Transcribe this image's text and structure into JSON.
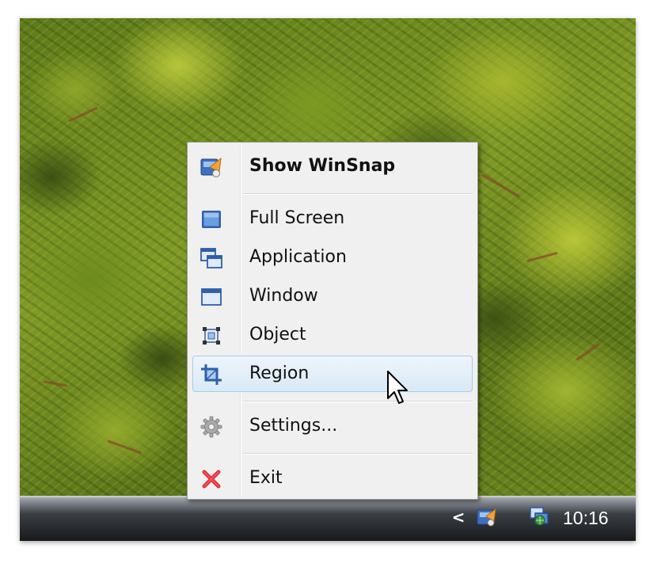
{
  "menu": {
    "items": [
      {
        "label": "Show WinSnap",
        "icon": "winsnap-app-icon",
        "bold": true
      },
      {
        "label": "Full Screen",
        "icon": "full-screen-icon"
      },
      {
        "label": "Application",
        "icon": "application-icon"
      },
      {
        "label": "Window",
        "icon": "window-icon"
      },
      {
        "label": "Object",
        "icon": "object-icon"
      },
      {
        "label": "Region",
        "icon": "region-icon",
        "highlighted": true
      },
      {
        "label": "Settings...",
        "icon": "gear-icon"
      },
      {
        "label": "Exit",
        "icon": "exit-x-icon"
      }
    ]
  },
  "taskbar": {
    "clock": "10:16",
    "tray_arrow": "<",
    "tray_icons": [
      "winsnap-tray-icon",
      "network-icon"
    ]
  },
  "colors": {
    "menu_background": "#f0f0f0",
    "highlight_border": "#a8cbe6",
    "icon_blue": "#2f5fa8",
    "exit_red": "#e0303a"
  }
}
